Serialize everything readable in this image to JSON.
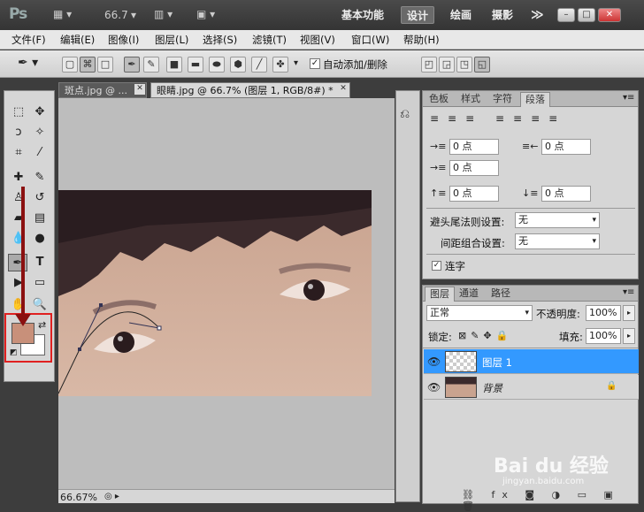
{
  "title_bar": {
    "logo": "Ps",
    "zoom": "66.7",
    "workspaces": [
      "基本功能",
      "设计",
      "绘画",
      "摄影"
    ],
    "more": "≫"
  },
  "menu": [
    "文件(F)",
    "编辑(E)",
    "图像(I)",
    "图层(L)",
    "选择(S)",
    "滤镜(T)",
    "视图(V)",
    "窗口(W)",
    "帮助(H)"
  ],
  "options_bar": {
    "auto_add_delete": "自动添加/删除",
    "auto_checked": true
  },
  "document": {
    "tabs": [
      "斑点.jpg @ ...",
      "眼睛.jpg @ 66.7% (图层 1, RGB/8#) *"
    ],
    "zoom_status": "66.67%"
  },
  "colors": {
    "foreground": "#c8907a",
    "background": "#ffffff",
    "selection": "#3399ff",
    "highlight_box": "#e02020"
  },
  "paragraph_panel": {
    "tabs": [
      "色板",
      "样式",
      "字符",
      "段落"
    ],
    "indent_left": "0 点",
    "indent_right": "0 点",
    "indent_first": "0 点",
    "space_before": "0 点",
    "space_after": "0 点",
    "kinsoku_label": "避头尾法则设置:",
    "kinsoku_value": "无",
    "mojikumi_label": "间距组合设置:",
    "mojikumi_value": "无",
    "hyphenate_label": "连字"
  },
  "layers_panel": {
    "tabs": [
      "图层",
      "通道",
      "路径"
    ],
    "blend_mode": "正常",
    "opacity_label": "不透明度:",
    "opacity_value": "100%",
    "lock_label": "锁定:",
    "fill_label": "填充:",
    "fill_value": "100%",
    "layers": [
      {
        "name": "图层 1",
        "selected": true
      },
      {
        "name": "背景",
        "selected": false,
        "locked": true
      }
    ]
  },
  "watermark": {
    "text": "Bai du 经验",
    "url": "jingyan.baidu.com"
  }
}
